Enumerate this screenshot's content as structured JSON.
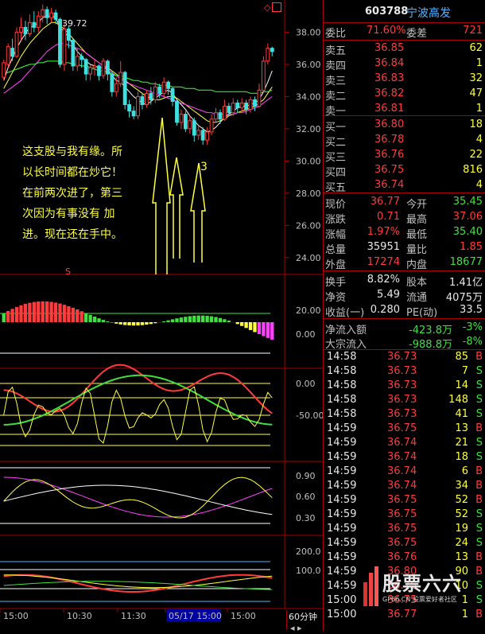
{
  "header": {
    "code": "603788",
    "name": "宁波高发",
    "marker": "◇"
  },
  "order_book": {
    "wei_bi_label": "委比",
    "wei_bi": "71.60%",
    "wei_cha_label": "委差",
    "wei_cha": "721",
    "asks": [
      {
        "label": "卖五",
        "price": "36.85",
        "vol": "62"
      },
      {
        "label": "卖四",
        "price": "36.84",
        "vol": "1"
      },
      {
        "label": "卖三",
        "price": "36.83",
        "vol": "32"
      },
      {
        "label": "卖二",
        "price": "36.82",
        "vol": "47"
      },
      {
        "label": "卖一",
        "price": "36.81",
        "vol": "1"
      }
    ],
    "bids": [
      {
        "label": "买一",
        "price": "36.80",
        "vol": "18"
      },
      {
        "label": "买二",
        "price": "36.78",
        "vol": "4"
      },
      {
        "label": "买三",
        "price": "36.76",
        "vol": "22"
      },
      {
        "label": "买四",
        "price": "36.75",
        "vol": "816"
      },
      {
        "label": "买五",
        "price": "36.74",
        "vol": "4"
      }
    ]
  },
  "quote": [
    {
      "l1": "现价",
      "v1": "36.77",
      "c1": "red",
      "l2": "今开",
      "v2": "35.45",
      "c2": "grn"
    },
    {
      "l1": "涨跌",
      "v1": "0.71",
      "c1": "red",
      "l2": "最高",
      "v2": "37.06",
      "c2": "red"
    },
    {
      "l1": "涨幅",
      "v1": "1.97%",
      "c1": "red",
      "l2": "最低",
      "v2": "35.40",
      "c2": "grn"
    },
    {
      "l1": "总量",
      "v1": "35951",
      "c1": "wht",
      "l2": "量比",
      "v2": "1.85",
      "c2": "red"
    },
    {
      "l1": "外盘",
      "v1": "17274",
      "c1": "red",
      "l2": "内盘",
      "v2": "18677",
      "c2": "grn"
    }
  ],
  "fundamentals": [
    {
      "l1": "换手",
      "v1": "8.82%",
      "l2": "股本",
      "v2": "1.41亿"
    },
    {
      "l1": "净资",
      "v1": "5.49",
      "l2": "流通",
      "v2": "4075万"
    },
    {
      "l1": "收益(一)",
      "v1": "0.280",
      "l2": "PE(动)",
      "v2": "33.5"
    }
  ],
  "flows": [
    {
      "label": "净流入额",
      "value": "-423.8万",
      "pct": "-3%"
    },
    {
      "label": "大宗流入",
      "value": "-988.8万",
      "pct": "-8%"
    }
  ],
  "trades": [
    {
      "t": "14:58",
      "p": "36.73",
      "v": "85",
      "s": "B"
    },
    {
      "t": "14:58",
      "p": "36.73",
      "v": "7",
      "s": "S"
    },
    {
      "t": "14:58",
      "p": "36.73",
      "v": "14",
      "s": "S"
    },
    {
      "t": "14:58",
      "p": "36.73",
      "v": "148",
      "s": "S"
    },
    {
      "t": "14:58",
      "p": "36.73",
      "v": "41",
      "s": "S"
    },
    {
      "t": "14:59",
      "p": "36.75",
      "v": "13",
      "s": "B"
    },
    {
      "t": "14:59",
      "p": "36.74",
      "v": "21",
      "s": "S"
    },
    {
      "t": "14:59",
      "p": "36.74",
      "v": "18",
      "s": "S"
    },
    {
      "t": "14:59",
      "p": "36.74",
      "v": "6",
      "s": "B"
    },
    {
      "t": "14:59",
      "p": "36.74",
      "v": "34",
      "s": "B"
    },
    {
      "t": "14:59",
      "p": "36.75",
      "v": "52",
      "s": "B"
    },
    {
      "t": "14:59",
      "p": "36.75",
      "v": "52",
      "s": "S"
    },
    {
      "t": "14:59",
      "p": "36.75",
      "v": "19",
      "s": "S"
    },
    {
      "t": "14:59",
      "p": "36.75",
      "v": "24",
      "s": "S"
    },
    {
      "t": "14:59",
      "p": "36.76",
      "v": "13",
      "s": "B"
    },
    {
      "t": "14:59",
      "p": "36.80",
      "v": "90",
      "s": "B"
    },
    {
      "t": "14:59",
      "p": "36.75",
      "v": "10",
      "s": "S"
    },
    {
      "t": "15:00",
      "p": "36.75",
      "v": "1",
      "s": "S"
    },
    {
      "t": "15:00",
      "p": "36.77",
      "v": "1",
      "s": "B"
    }
  ],
  "watermark": {
    "main": "股票六六",
    "sub": "GP66.CN 股票爱好者社区"
  },
  "chart_data": {
    "type": "candlestick",
    "period_label": "60分钟",
    "price_ticks": [
      "38.00",
      "36.00",
      "34.00",
      "32.00",
      "30.00",
      "28.00",
      "26.00",
      "24.00"
    ],
    "high_label": "39.72",
    "ylim": [
      23.2,
      39.8
    ],
    "candles": [
      [
        35.2,
        36.1,
        35.0,
        36.3
      ],
      [
        36.0,
        37.1,
        35.8,
        37.3
      ],
      [
        37.0,
        36.5,
        36.2,
        37.6
      ],
      [
        36.5,
        38.0,
        36.4,
        38.3
      ],
      [
        38.0,
        38.3,
        37.5,
        38.9
      ],
      [
        38.3,
        37.9,
        37.5,
        38.7
      ],
      [
        37.9,
        38.6,
        37.7,
        39.1
      ],
      [
        38.6,
        38.3,
        38.0,
        39.3
      ],
      [
        38.3,
        39.0,
        38.0,
        39.3
      ],
      [
        39.0,
        39.4,
        38.6,
        39.72
      ],
      [
        39.4,
        38.9,
        38.5,
        39.6
      ],
      [
        38.9,
        39.2,
        38.6,
        39.5
      ],
      [
        39.2,
        38.8,
        38.5,
        39.4
      ],
      [
        38.8,
        36.0,
        35.8,
        38.9
      ],
      [
        36.0,
        38.2,
        35.6,
        38.6
      ],
      [
        38.2,
        37.5,
        37.0,
        38.4
      ],
      [
        37.5,
        35.9,
        35.6,
        37.6
      ],
      [
        35.9,
        36.5,
        35.6,
        37.0
      ],
      [
        36.5,
        36.3,
        35.8,
        36.7
      ],
      [
        36.3,
        35.4,
        35.0,
        36.4
      ],
      [
        35.4,
        35.8,
        35.0,
        36.0
      ],
      [
        35.8,
        35.9,
        35.3,
        36.3
      ],
      [
        35.9,
        35.3,
        35.0,
        36.0
      ],
      [
        35.3,
        36.2,
        35.1,
        36.4
      ],
      [
        36.2,
        35.4,
        35.0,
        36.3
      ],
      [
        35.4,
        34.3,
        34.0,
        35.6
      ],
      [
        34.3,
        34.8,
        34.0,
        35.2
      ],
      [
        34.8,
        35.5,
        34.6,
        36.2
      ],
      [
        35.5,
        33.5,
        33.2,
        35.6
      ],
      [
        33.5,
        33.1,
        32.7,
        33.8
      ],
      [
        33.1,
        32.8,
        32.6,
        33.4
      ],
      [
        32.8,
        34.0,
        32.6,
        34.3
      ],
      [
        34.0,
        33.5,
        33.2,
        34.2
      ],
      [
        33.5,
        34.2,
        33.3,
        34.4
      ],
      [
        34.2,
        33.8,
        33.5,
        34.6
      ],
      [
        33.8,
        34.6,
        33.6,
        34.9
      ],
      [
        34.6,
        34.2,
        33.9,
        34.8
      ],
      [
        34.2,
        34.9,
        34.0,
        35.2
      ],
      [
        34.9,
        34.5,
        34.1,
        35.0
      ],
      [
        34.5,
        33.7,
        33.4,
        34.6
      ],
      [
        33.7,
        32.4,
        32.2,
        33.8
      ],
      [
        32.4,
        32.9,
        32.0,
        33.2
      ],
      [
        32.9,
        32.0,
        31.8,
        33.1
      ],
      [
        32.0,
        32.5,
        31.7,
        32.8
      ],
      [
        32.5,
        31.6,
        31.2,
        32.7
      ],
      [
        31.6,
        31.9,
        31.3,
        32.2
      ],
      [
        31.9,
        31.3,
        31.0,
        32.1
      ],
      [
        31.3,
        31.8,
        31.0,
        32.1
      ],
      [
        31.8,
        32.6,
        31.6,
        32.9
      ],
      [
        32.6,
        33.0,
        32.4,
        33.3
      ],
      [
        33.0,
        32.6,
        32.3,
        33.2
      ],
      [
        32.6,
        33.4,
        32.5,
        33.8
      ],
      [
        33.4,
        33.0,
        32.8,
        33.6
      ],
      [
        33.0,
        33.6,
        32.8,
        33.9
      ],
      [
        33.6,
        33.3,
        33.0,
        33.8
      ],
      [
        33.3,
        33.6,
        33.0,
        33.9
      ],
      [
        33.6,
        33.2,
        32.9,
        33.8
      ],
      [
        33.2,
        33.8,
        33.0,
        34.0
      ],
      [
        33.8,
        33.4,
        33.1,
        34.0
      ],
      [
        33.4,
        34.4,
        33.3,
        34.8
      ],
      [
        34.4,
        36.2,
        34.3,
        36.5
      ],
      [
        36.2,
        37.0,
        36.0,
        37.3
      ],
      [
        37.0,
        36.8,
        36.5,
        37.1
      ]
    ],
    "ma_lines": [
      {
        "name": "MA5",
        "color": "#ffffff",
        "values": [
          35.0,
          35.8,
          36.4,
          37.0,
          37.5,
          37.9,
          38.3,
          38.4,
          38.6,
          38.9,
          39.0,
          39.0,
          38.9,
          38.3,
          38.0,
          37.7,
          37.2,
          36.8,
          36.5,
          36.2,
          36.0,
          35.9,
          35.8,
          35.8,
          35.7,
          35.3,
          35.0,
          34.9,
          34.6,
          34.3,
          34.0,
          33.8,
          33.6,
          33.5,
          33.7,
          33.9,
          34.1,
          34.3,
          34.4,
          34.2,
          33.8,
          33.5,
          33.2,
          32.8,
          32.5,
          32.2,
          32.0,
          31.8,
          31.9,
          32.1,
          32.4,
          32.7,
          32.9,
          33.1,
          33.3,
          33.4,
          33.4,
          33.5,
          33.6,
          33.8,
          34.3,
          34.9,
          35.6
        ]
      },
      {
        "name": "MA10",
        "color": "#ffff40",
        "values": [
          34.5,
          35.0,
          35.5,
          36.0,
          36.5,
          36.9,
          37.3,
          37.6,
          37.9,
          38.2,
          38.4,
          38.6,
          38.6,
          38.4,
          38.2,
          37.9,
          37.6,
          37.3,
          37.0,
          36.7,
          36.5,
          36.3,
          36.1,
          35.9,
          35.8,
          35.6,
          35.4,
          35.2,
          35.0,
          34.8,
          34.6,
          34.4,
          34.2,
          34.0,
          33.9,
          33.8,
          33.8,
          33.9,
          34.0,
          34.0,
          33.9,
          33.7,
          33.5,
          33.3,
          33.1,
          32.9,
          32.7,
          32.5,
          32.4,
          32.4,
          32.5,
          32.6,
          32.8,
          32.9,
          33.0,
          33.1,
          33.2,
          33.3,
          33.4,
          33.6,
          33.8,
          34.2,
          34.6
        ]
      },
      {
        "name": "MA20",
        "color": "#ff40ff",
        "values": [
          34.2,
          34.4,
          34.6,
          34.8,
          35.0,
          35.3,
          35.6,
          35.9,
          36.2,
          36.5,
          36.8,
          37.0,
          37.2,
          37.3,
          37.3,
          37.2,
          37.1,
          37.0,
          36.9,
          36.7,
          36.5,
          36.3,
          36.1,
          35.9,
          35.7,
          35.5,
          35.3,
          35.1,
          34.9,
          34.8,
          34.7,
          34.6,
          34.5,
          34.4,
          34.3,
          34.2,
          34.1,
          34.0,
          33.9,
          33.8,
          33.7,
          33.6,
          33.5,
          33.4,
          33.3,
          33.2,
          33.1,
          33.0,
          33.0,
          32.9,
          32.9,
          32.9,
          32.9,
          32.9,
          33.0,
          33.0,
          33.1,
          33.2,
          33.3,
          33.4,
          33.6,
          33.8,
          34.0
        ]
      },
      {
        "name": "MA60",
        "color": "#40ff40",
        "values": [
          35.4,
          35.5,
          35.6,
          35.7,
          35.8,
          35.9,
          36.0,
          36.0,
          36.1,
          36.1,
          36.2,
          36.2,
          36.2,
          36.2,
          36.1,
          36.1,
          36.0,
          36.0,
          35.9,
          35.9,
          35.8,
          35.7,
          35.6,
          35.6,
          35.5,
          35.4,
          35.3,
          35.3,
          35.2,
          35.1,
          35.0,
          35.0,
          34.9,
          34.9,
          34.8,
          34.8,
          34.7,
          34.7,
          34.7,
          34.6,
          34.6,
          34.6,
          34.5,
          34.5,
          34.5,
          34.4,
          34.4,
          34.4,
          34.4,
          34.3,
          34.3,
          34.3,
          34.3,
          34.3,
          34.3,
          34.3,
          34.3,
          34.2,
          34.2,
          34.2,
          34.3,
          34.3,
          34.4
        ]
      }
    ],
    "annotation_text": [
      "这支股与我有缘。所",
      "以长时间都在炒它！",
      "在前两次进了，第三",
      "次因为有事没有 加",
      "进。现在还在手中。"
    ],
    "annotation_mark": "3",
    "indicator1_ticks": [
      "20.00",
      "0.00"
    ],
    "indicator2_ticks": [
      "0.00",
      "-50.00"
    ],
    "indicator3_ticks": [
      "0.90",
      "0.60",
      "0.30"
    ],
    "indicator4_ticks": [
      "200.0",
      "100.0"
    ],
    "time_labels": [
      "15:00",
      "10:30",
      "11:30",
      "05/17 15:00",
      "15:00"
    ],
    "s_mark": "S"
  }
}
